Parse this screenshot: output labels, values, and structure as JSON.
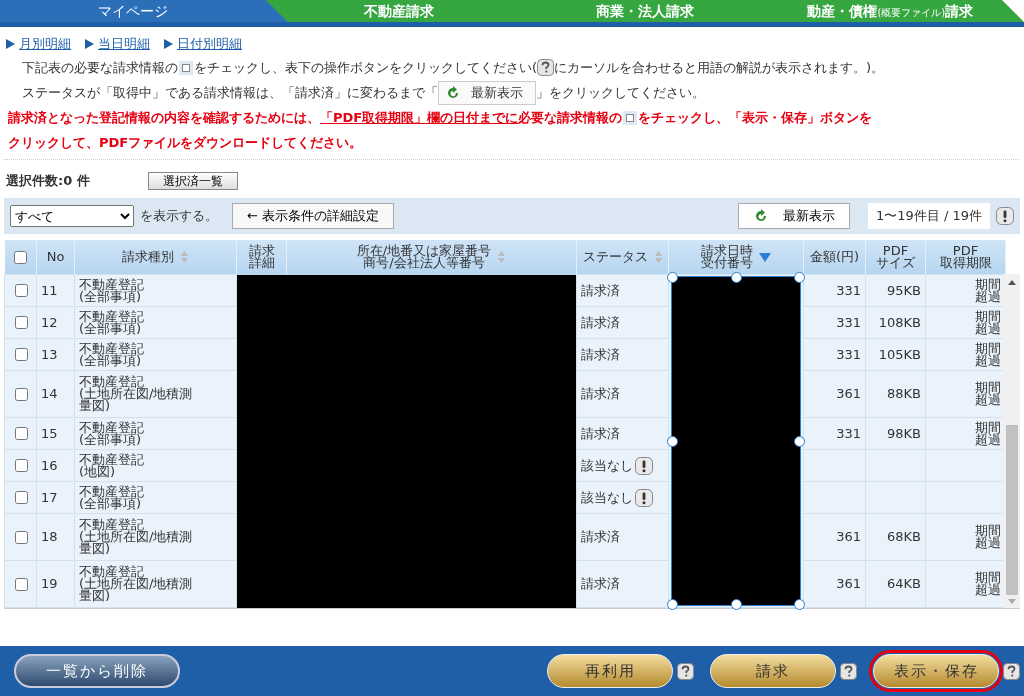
{
  "tabs": [
    {
      "label": "マイページ",
      "selected": true
    },
    {
      "label": "不動産請求",
      "selected": false
    },
    {
      "label": "商業・法人請求",
      "selected": false
    },
    {
      "label": "動産・債権",
      "note": "(概要ファイル)",
      "suffix": "請求",
      "selected": false
    }
  ],
  "links": [
    "月別明細",
    "当日明細",
    "日付別明細"
  ],
  "instructions": [
    [
      {
        "kind": "text",
        "text": "下記表の必要な請求情報の"
      },
      {
        "kind": "checkbox"
      },
      {
        "kind": "text",
        "text": "をチェックし、表下の操作ボタンをクリックしてください("
      },
      {
        "kind": "help"
      },
      {
        "kind": "text",
        "text": " にカーソルを合わせると用語の解説が表示されます。)。"
      }
    ],
    [
      {
        "kind": "text",
        "text": "ステータスが「取得中」である請求情報は、「請求済」に変わるまで「"
      },
      {
        "kind": "button",
        "text": "最新表示"
      },
      {
        "kind": "text",
        "text": "」をクリックしてください。"
      }
    ]
  ],
  "warning": [
    [
      {
        "kind": "text",
        "text": "請求済となった登記情報の内容を確認するためには、"
      },
      {
        "kind": "underline",
        "text": "「PDF取得期限」欄の日付までに"
      },
      {
        "kind": "text",
        "text": "必要な請求情報の"
      },
      {
        "kind": "checkbox"
      },
      {
        "kind": "text",
        "text": "をチェックし、「表示・保存」ボタンを"
      }
    ],
    [
      {
        "kind": "text",
        "text": "クリックして、PDFファイルをダウンロードしてください。"
      }
    ]
  ],
  "selected_count": "選択件数:0 件",
  "selected_list_button": "選択済一覧",
  "filter": {
    "value": "すべて",
    "suffix": "を表示する。",
    "detail_button": "← 表示条件の詳細設定",
    "refresh_button": "最新表示",
    "range": "1〜19件目 / 19件"
  },
  "table": {
    "all_checked": false,
    "columns": [
      {
        "label": [
          "No"
        ]
      },
      {
        "label": [
          "請求種別"
        ],
        "sortable": true
      },
      {
        "label": [
          "請求詳細"
        ]
      },
      {
        "label": [
          "所在/地番又は家屋番号",
          "商号/会社法人等番号"
        ],
        "sortable": true
      },
      {
        "label": [
          "ステータス"
        ],
        "sortable": true
      },
      {
        "label": [
          "請求日時",
          "受付番号"
        ],
        "sorted": true
      },
      {
        "label": [
          "金額(円)"
        ]
      },
      {
        "label": [
          "PDF",
          "サイズ"
        ]
      },
      {
        "label": [
          "PDF",
          "取得期限"
        ]
      }
    ],
    "rows": [
      {
        "checked": false,
        "no": "11",
        "type": "不動産登記",
        "detail": "(全部事項)",
        "status": "請求済",
        "alert": false,
        "amount": "331",
        "size": "95KB",
        "deadline": "期間超過"
      },
      {
        "checked": false,
        "no": "12",
        "type": "不動産登記",
        "detail": "(全部事項)",
        "status": "請求済",
        "alert": false,
        "amount": "331",
        "size": "108KB",
        "deadline": "期間超過"
      },
      {
        "checked": false,
        "no": "13",
        "type": "不動産登記",
        "detail": "(全部事項)",
        "status": "請求済",
        "alert": false,
        "amount": "331",
        "size": "105KB",
        "deadline": "期間超過"
      },
      {
        "checked": false,
        "no": "14",
        "type": "不動産登記",
        "detail": "(土地所在図/地積測量図)",
        "status": "請求済",
        "alert": false,
        "amount": "361",
        "size": "88KB",
        "deadline": "期間超過"
      },
      {
        "checked": false,
        "no": "15",
        "type": "不動産登記",
        "detail": "(全部事項)",
        "status": "請求済",
        "alert": false,
        "amount": "331",
        "size": "98KB",
        "deadline": "期間超過"
      },
      {
        "checked": false,
        "no": "16",
        "type": "不動産登記",
        "detail": "(地図)",
        "status": "該当なし",
        "alert": true
      },
      {
        "checked": false,
        "no": "17",
        "type": "不動産登記",
        "detail": "(全部事項)",
        "status": "該当なし",
        "alert": true
      },
      {
        "checked": false,
        "no": "18",
        "type": "不動産登記",
        "detail": "(土地所在図/地積測量図)",
        "status": "請求済",
        "alert": false,
        "amount": "361",
        "size": "68KB",
        "deadline": "期間超過"
      },
      {
        "checked": false,
        "no": "19",
        "type": "不動産登記",
        "detail": "(土地所在図/地積測量図)",
        "status": "請求済",
        "alert": false,
        "amount": "361",
        "size": "64KB",
        "deadline": "期間超過"
      }
    ]
  },
  "footer": {
    "delete_button": "一覧から削除",
    "actions": [
      {
        "label": "再利用",
        "highlighted": false
      },
      {
        "label": "請求",
        "highlighted": false
      },
      {
        "label": "表示・保存",
        "highlighted": true
      }
    ]
  }
}
